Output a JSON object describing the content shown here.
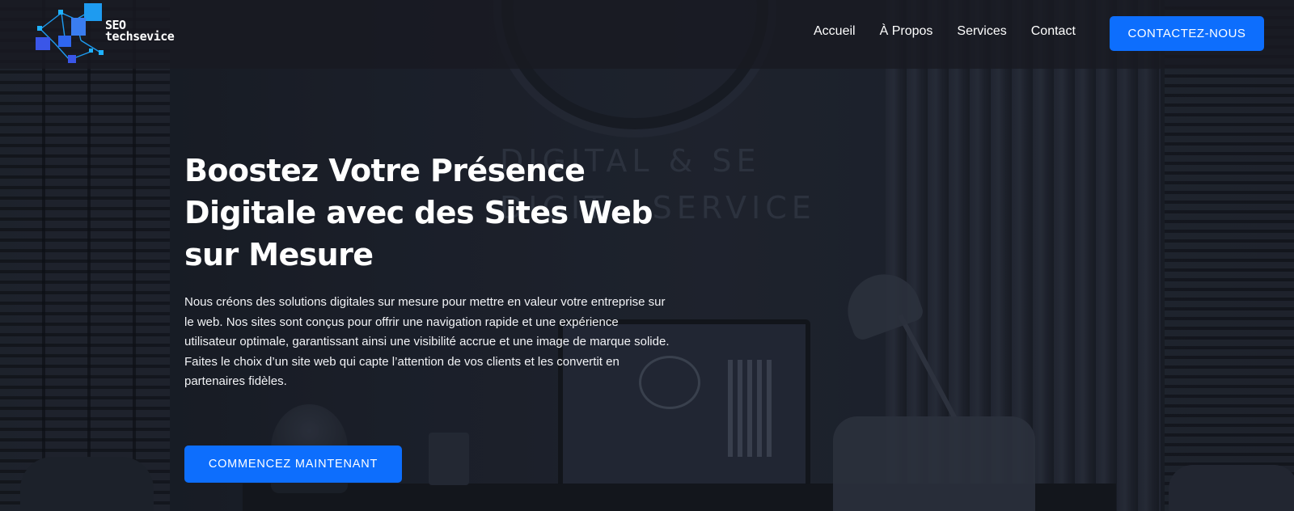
{
  "brand": {
    "name_line1": "SEO",
    "name_line2": "techsevice",
    "logo_colors": [
      "#1e9bf0",
      "#3a56e8",
      "#1fb2ff"
    ]
  },
  "nav": {
    "items": [
      {
        "label": "Accueil"
      },
      {
        "label": "À Propos"
      },
      {
        "label": "Services"
      },
      {
        "label": "Contact"
      }
    ],
    "cta_label": "CONTACTEZ-NOUS"
  },
  "hero": {
    "title": "Boostez Votre Présence Digitale avec des Sites Web sur Mesure",
    "description": "Nous créons des solutions digitales sur mesure pour mettre en valeur votre entreprise sur le web. Nos sites sont conçus pour offrir une navigation rapide et une expérience utilisateur optimale, garantissant ainsi une visibilité accrue et une image de marque solide. Faites le choix d’un site web qui capte l’attention de vos clients et les convertit en partenaires fidèles.",
    "cta_label": "COMMENCEZ MAINTENANT",
    "background_wall_text_line1": "DIGITAL & SE",
    "background_wall_text_line2": "DIGIT   SERVICE"
  },
  "colors": {
    "accent": "#0d6efd",
    "text": "#ffffff"
  }
}
